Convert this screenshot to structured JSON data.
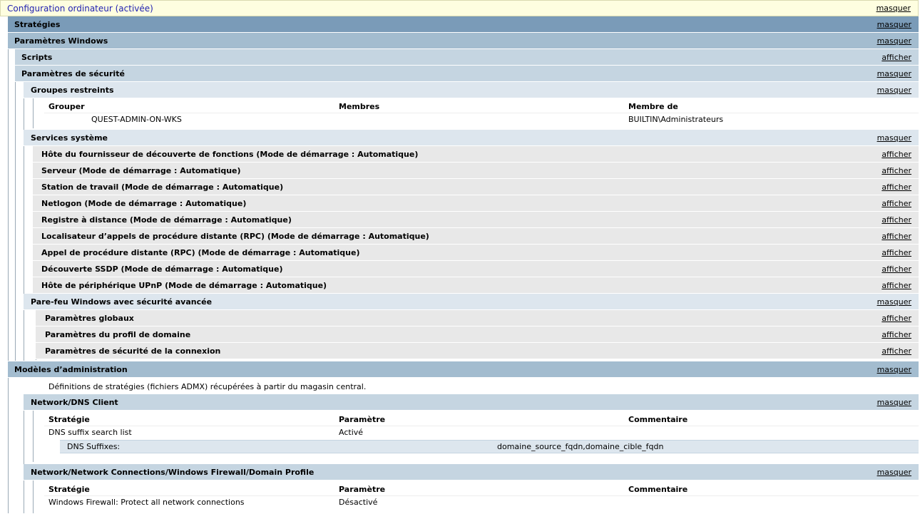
{
  "root": {
    "title": "Configuration ordinateur (activée)",
    "action": "masquer"
  },
  "strategies": {
    "title": "Stratégies",
    "action": "masquer"
  },
  "windows": {
    "title": "Paramètres Windows",
    "action": "masquer"
  },
  "scripts": {
    "title": "Scripts",
    "action": "afficher"
  },
  "security": {
    "title": "Paramètres de sécurité",
    "action": "masquer"
  },
  "restricted": {
    "title": "Groupes restreints",
    "action": "masquer",
    "headers": [
      "Grouper",
      "Membres",
      "Membre de"
    ],
    "rows": [
      [
        "QUEST-ADMIN-ON-WKS",
        "",
        "BUILTIN\\Administrateurs"
      ]
    ]
  },
  "services": {
    "title": "Services système",
    "action": "masquer",
    "items": [
      {
        "label": "Hôte du fournisseur de découverte de fonctions (Mode de démarrage : Automatique)",
        "action": "afficher"
      },
      {
        "label": "Serveur (Mode de démarrage : Automatique)",
        "action": "afficher"
      },
      {
        "label": "Station de travail (Mode de démarrage : Automatique)",
        "action": "afficher"
      },
      {
        "label": "Netlogon (Mode de démarrage : Automatique)",
        "action": "afficher"
      },
      {
        "label": "Registre à distance (Mode de démarrage : Automatique)",
        "action": "afficher"
      },
      {
        "label": "Localisateur d’appels de procédure distante (RPC) (Mode de démarrage : Automatique)",
        "action": "afficher"
      },
      {
        "label": "Appel de procédure distante (RPC) (Mode de démarrage : Automatique)",
        "action": "afficher"
      },
      {
        "label": "Découverte SSDP (Mode de démarrage : Automatique)",
        "action": "afficher"
      },
      {
        "label": "Hôte de périphérique UPnP (Mode de démarrage : Automatique)",
        "action": "afficher"
      }
    ]
  },
  "firewall": {
    "title": "Pare-feu Windows avec sécurité avancée",
    "action": "masquer",
    "items": [
      {
        "label": "Paramètres globaux",
        "action": "afficher"
      },
      {
        "label": "Paramètres du profil de domaine",
        "action": "afficher"
      },
      {
        "label": "Paramètres de sécurité de la connexion",
        "action": "afficher"
      }
    ]
  },
  "admin": {
    "title": "Modèles d’administration",
    "action": "masquer",
    "note": "Définitions de stratégies (fichiers ADMX) récupérées à partir du magasin central."
  },
  "dns": {
    "title": "Network/DNS Client",
    "action": "masquer",
    "headers": [
      "Stratégie",
      "Paramètre",
      "Commentaire"
    ],
    "row": [
      "DNS suffix search list",
      "Activé",
      ""
    ],
    "sub": {
      "label": "DNS Suffixes:",
      "value": "domaine_source_fqdn,domaine_cible_fqdn"
    }
  },
  "netfw": {
    "title": "Network/Network Connections/Windows Firewall/Domain Profile",
    "action": "masquer",
    "headers": [
      "Stratégie",
      "Paramètre",
      "Commentaire"
    ],
    "row": [
      "Windows Firewall: Protect all network connections",
      "Désactivé",
      ""
    ]
  }
}
